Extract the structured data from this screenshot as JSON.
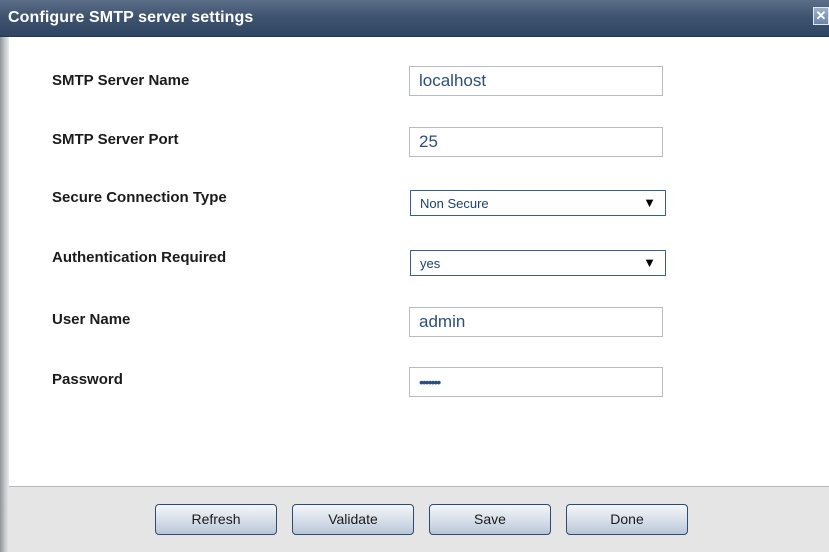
{
  "dialog": {
    "title": "Configure SMTP server settings",
    "close_glyph": "✕",
    "close_icon": "close-icon"
  },
  "form": {
    "server_name": {
      "label": "SMTP Server Name",
      "value": "localhost"
    },
    "server_port": {
      "label": "SMTP Server Port",
      "value": "25"
    },
    "secure_type": {
      "label": "Secure Connection Type",
      "value": "Non Secure"
    },
    "auth_required": {
      "label": "Authentication Required",
      "value": "yes"
    },
    "user_name": {
      "label": "User Name",
      "value": "admin"
    },
    "password": {
      "label": "Password",
      "value": "•••••••"
    },
    "dropdown_glyph": "▼",
    "dropdown_icon": "chevron-down-icon"
  },
  "buttons": {
    "refresh": "Refresh",
    "validate": "Validate",
    "save": "Save",
    "done": "Done"
  },
  "colors": {
    "titlebar": "#3f5471",
    "field_text": "#2a4e7e",
    "select_border": "#3a5d98"
  }
}
